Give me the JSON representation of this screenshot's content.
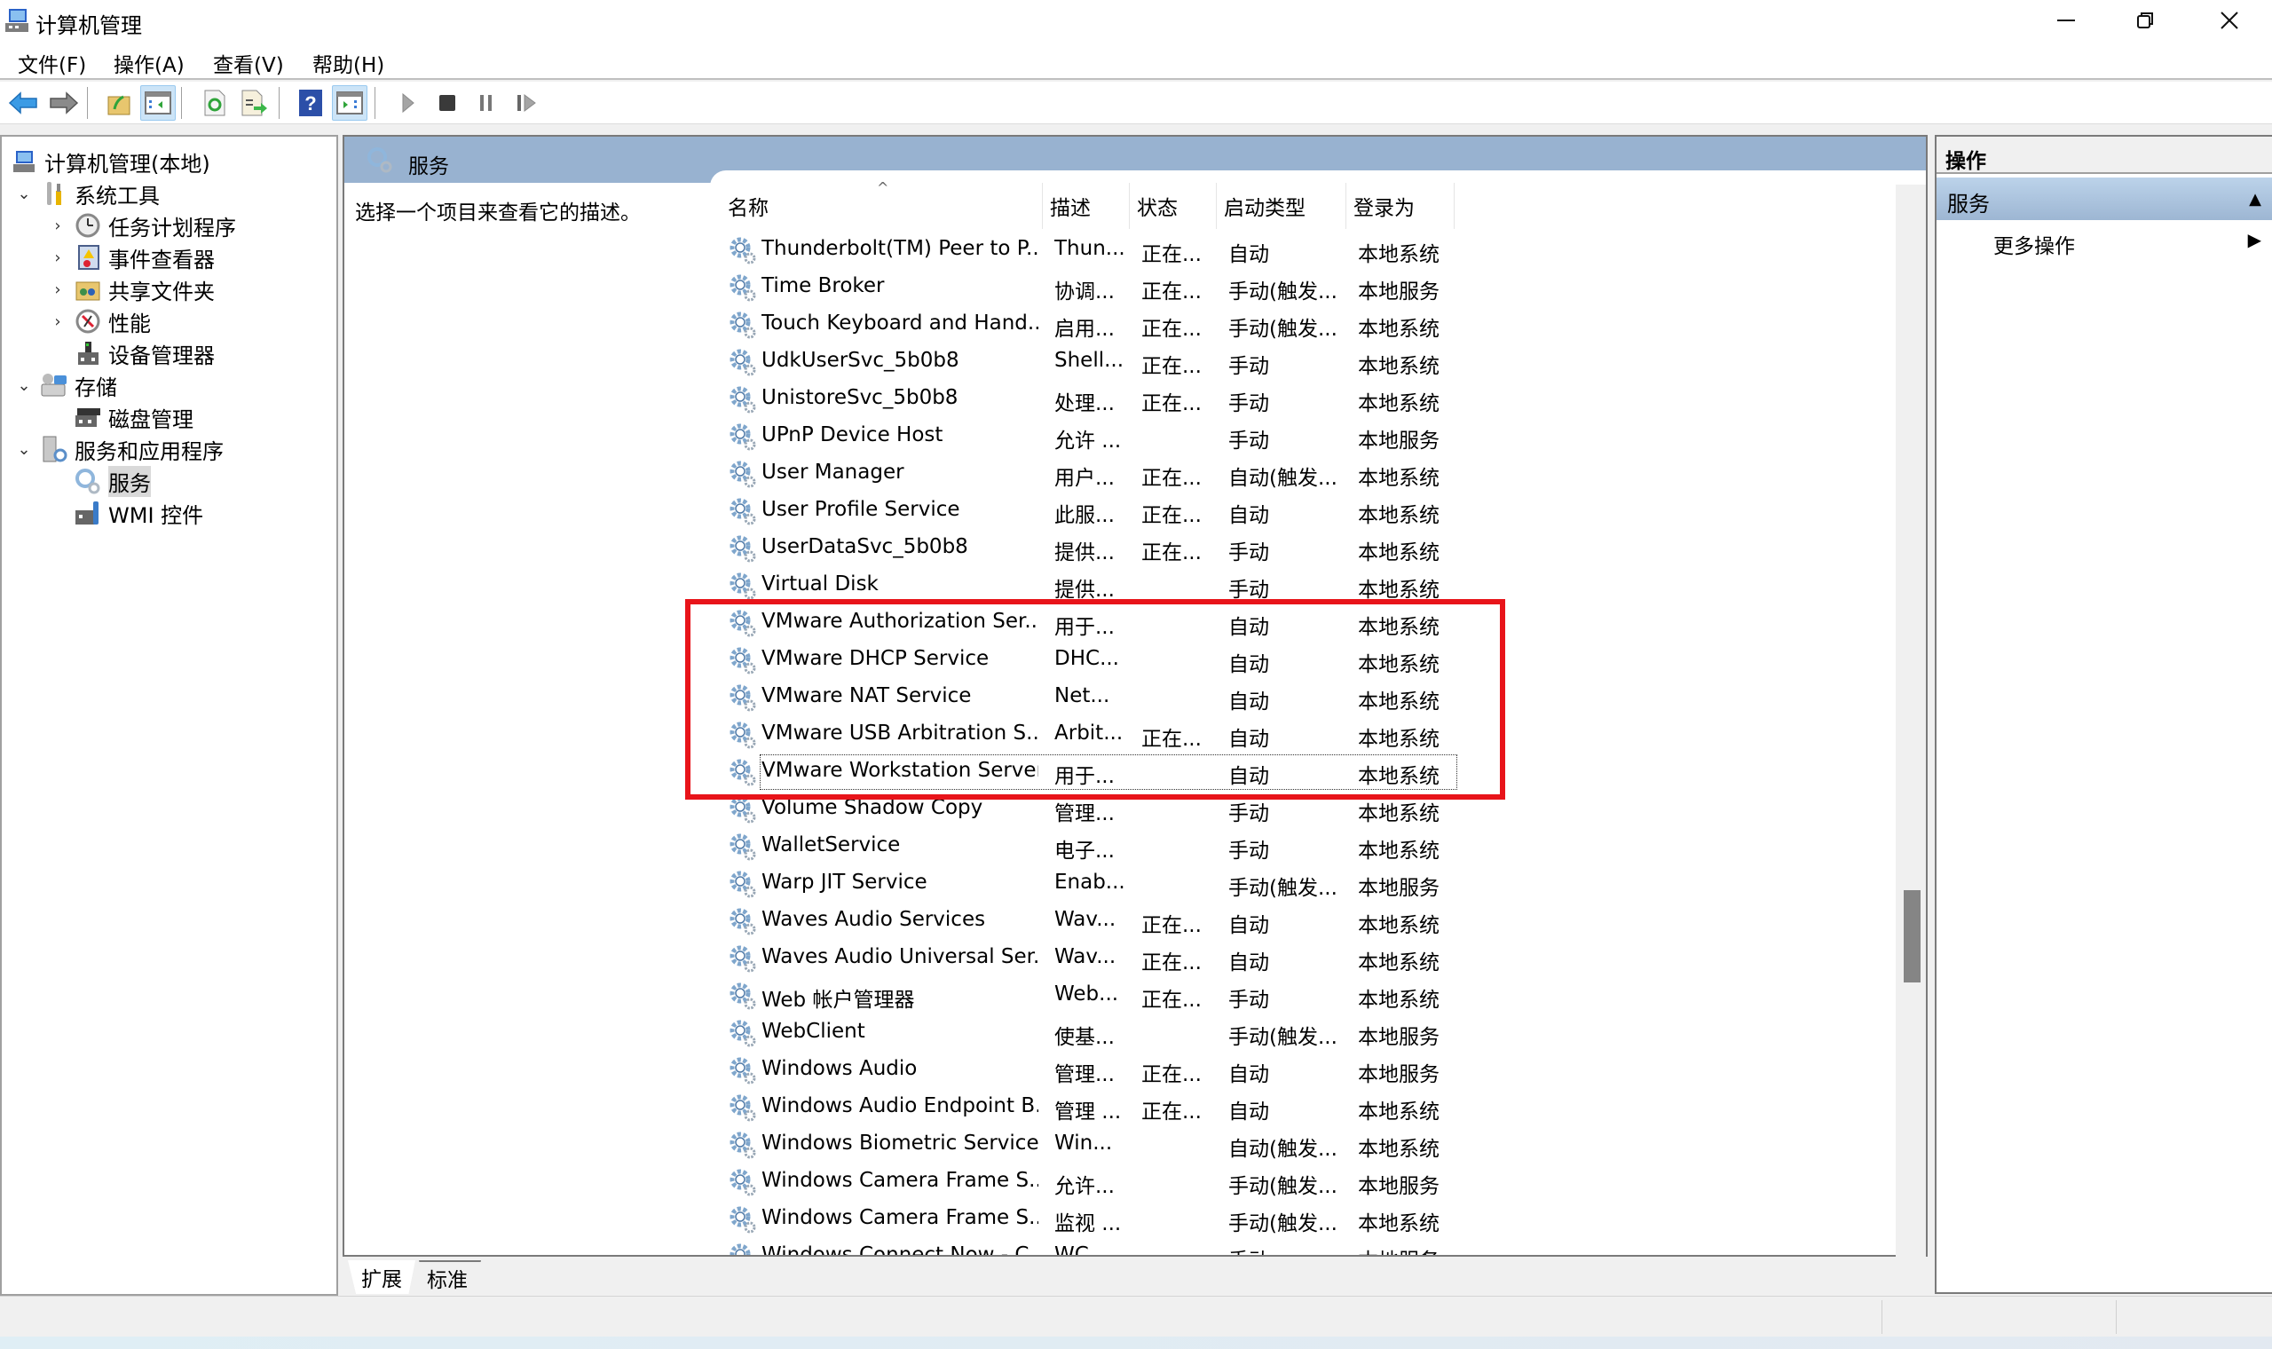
{
  "window": {
    "title": "计算机管理",
    "controls": {
      "minimize": "—",
      "maximize": "❐",
      "close": "✕"
    }
  },
  "menu": [
    {
      "label": "文件(F)"
    },
    {
      "label": "操作(A)"
    },
    {
      "label": "查看(V)"
    },
    {
      "label": "帮助(H)"
    }
  ],
  "toolbar": {
    "buttons": [
      {
        "icon": "back-arrow-icon",
        "label": "后退"
      },
      {
        "icon": "forward-arrow-icon",
        "label": "前进"
      },
      {
        "icon": "up-folder-icon",
        "label": "向上一级"
      },
      {
        "icon": "show-hide-console-tree-icon",
        "label": "显示/隐藏控制台树",
        "active": true
      },
      {
        "icon": "refresh-icon",
        "label": "刷新"
      },
      {
        "icon": "export-list-icon",
        "label": "导出列表"
      },
      {
        "icon": "help-icon",
        "label": "帮助"
      },
      {
        "icon": "show-hide-action-pane-icon",
        "label": "显示/隐藏操作窗格",
        "active": true
      },
      {
        "icon": "start-service-icon",
        "label": "启动服务"
      },
      {
        "icon": "stop-service-icon",
        "label": "停止服务"
      },
      {
        "icon": "pause-service-icon",
        "label": "暂停服务"
      },
      {
        "icon": "restart-service-icon",
        "label": "重新启动服务"
      }
    ]
  },
  "tree": [
    {
      "label": "计算机管理(本地)",
      "level": 0,
      "expander": "",
      "icon": "computer-management-icon"
    },
    {
      "label": "系统工具",
      "level": 1,
      "expander": "expanded",
      "icon": "system-tools-icon"
    },
    {
      "label": "任务计划程序",
      "level": 2,
      "expander": "collapsed",
      "icon": "task-scheduler-icon"
    },
    {
      "label": "事件查看器",
      "level": 2,
      "expander": "collapsed",
      "icon": "event-viewer-icon"
    },
    {
      "label": "共享文件夹",
      "level": 2,
      "expander": "collapsed",
      "icon": "shared-folders-icon"
    },
    {
      "label": "性能",
      "level": 2,
      "expander": "collapsed",
      "icon": "performance-icon"
    },
    {
      "label": "设备管理器",
      "level": 2,
      "expander": "",
      "icon": "device-manager-icon"
    },
    {
      "label": "存储",
      "level": 1,
      "expander": "expanded",
      "icon": "storage-icon"
    },
    {
      "label": "磁盘管理",
      "level": 2,
      "expander": "",
      "icon": "disk-management-icon"
    },
    {
      "label": "服务和应用程序",
      "level": 1,
      "expander": "expanded",
      "icon": "services-and-apps-icon"
    },
    {
      "label": "服务",
      "level": 2,
      "expander": "",
      "icon": "services-gear-icon",
      "selected": true
    },
    {
      "label": "WMI 控件",
      "level": 2,
      "expander": "",
      "icon": "wmi-control-icon"
    }
  ],
  "center": {
    "header_title": "服务",
    "description_hint": "选择一个项目来查看它的描述。",
    "columns": [
      {
        "key": "name",
        "label": "名称",
        "sorted": "ascending"
      },
      {
        "key": "desc",
        "label": "描述"
      },
      {
        "key": "status",
        "label": "状态"
      },
      {
        "key": "startup",
        "label": "启动类型"
      },
      {
        "key": "logon",
        "label": "登录为"
      }
    ],
    "sort_indicator": "^",
    "services": [
      {
        "name": "Thunderbolt(TM) Peer to P...",
        "desc": "Thun...",
        "status": "正在...",
        "startup": "自动",
        "logon": "本地系统"
      },
      {
        "name": "Time Broker",
        "desc": "协调...",
        "status": "正在...",
        "startup": "手动(触发...",
        "logon": "本地服务"
      },
      {
        "name": "Touch Keyboard and Hand...",
        "desc": "启用...",
        "status": "正在...",
        "startup": "手动(触发...",
        "logon": "本地系统"
      },
      {
        "name": "UdkUserSvc_5b0b8",
        "desc": "Shell...",
        "status": "正在...",
        "startup": "手动",
        "logon": "本地系统"
      },
      {
        "name": "UnistoreSvc_5b0b8",
        "desc": "处理...",
        "status": "正在...",
        "startup": "手动",
        "logon": "本地系统"
      },
      {
        "name": "UPnP Device Host",
        "desc": "允许 ...",
        "status": "",
        "startup": "手动",
        "logon": "本地服务"
      },
      {
        "name": "User Manager",
        "desc": "用户...",
        "status": "正在...",
        "startup": "自动(触发...",
        "logon": "本地系统"
      },
      {
        "name": "User Profile Service",
        "desc": "此服...",
        "status": "正在...",
        "startup": "自动",
        "logon": "本地系统"
      },
      {
        "name": "UserDataSvc_5b0b8",
        "desc": "提供...",
        "status": "正在...",
        "startup": "手动",
        "logon": "本地系统"
      },
      {
        "name": "Virtual Disk",
        "desc": "提供...",
        "status": "",
        "startup": "手动",
        "logon": "本地系统"
      },
      {
        "name": "VMware Authorization Ser...",
        "desc": "用于...",
        "status": "",
        "startup": "自动",
        "logon": "本地系统",
        "highlighted": true
      },
      {
        "name": "VMware DHCP Service",
        "desc": "DHC...",
        "status": "",
        "startup": "自动",
        "logon": "本地系统",
        "highlighted": true
      },
      {
        "name": "VMware NAT Service",
        "desc": "Net...",
        "status": "",
        "startup": "自动",
        "logon": "本地系统",
        "highlighted": true
      },
      {
        "name": "VMware USB Arbitration S...",
        "desc": "Arbit...",
        "status": "正在...",
        "startup": "自动",
        "logon": "本地系统",
        "highlighted": true
      },
      {
        "name": "VMware Workstation Server",
        "desc": "用于...",
        "status": "",
        "startup": "自动",
        "logon": "本地系统",
        "highlighted": true,
        "focused": true
      },
      {
        "name": "Volume Shadow Copy",
        "desc": "管理...",
        "status": "",
        "startup": "手动",
        "logon": "本地系统"
      },
      {
        "name": "WalletService",
        "desc": "电子...",
        "status": "",
        "startup": "手动",
        "logon": "本地系统"
      },
      {
        "name": "Warp JIT Service",
        "desc": "Enab...",
        "status": "",
        "startup": "手动(触发...",
        "logon": "本地服务"
      },
      {
        "name": "Waves Audio Services",
        "desc": "Wav...",
        "status": "正在...",
        "startup": "自动",
        "logon": "本地系统"
      },
      {
        "name": "Waves Audio Universal Ser...",
        "desc": "Wav...",
        "status": "正在...",
        "startup": "自动",
        "logon": "本地系统"
      },
      {
        "name": "Web 帐户管理器",
        "desc": "Web...",
        "status": "正在...",
        "startup": "手动",
        "logon": "本地系统"
      },
      {
        "name": "WebClient",
        "desc": "使基...",
        "status": "",
        "startup": "手动(触发...",
        "logon": "本地服务"
      },
      {
        "name": "Windows Audio",
        "desc": "管理...",
        "status": "正在...",
        "startup": "自动",
        "logon": "本地服务"
      },
      {
        "name": "Windows Audio Endpoint B...",
        "desc": "管理 ...",
        "status": "正在...",
        "startup": "自动",
        "logon": "本地系统"
      },
      {
        "name": "Windows Biometric Service",
        "desc": "Win...",
        "status": "",
        "startup": "自动(触发...",
        "logon": "本地系统"
      },
      {
        "name": "Windows Camera Frame S...",
        "desc": "允许...",
        "status": "",
        "startup": "手动(触发...",
        "logon": "本地服务"
      },
      {
        "name": "Windows Camera Frame S...",
        "desc": "监视 ...",
        "status": "",
        "startup": "手动(触发...",
        "logon": "本地系统"
      },
      {
        "name": "Windows Connect Now - C...",
        "desc": "WC...",
        "status": "",
        "startup": "手动",
        "logon": "本地服务"
      }
    ],
    "scroll_position_fraction": 0.72,
    "bottom_tabs": [
      {
        "label": "扩展",
        "active": true
      },
      {
        "label": "标准",
        "active": false
      }
    ]
  },
  "actions_pane": {
    "title": "操作",
    "section": "服务",
    "items": [
      {
        "label": "更多操作",
        "has_submenu": true
      }
    ],
    "collapse_glyph": "▲",
    "submenu_glyph": "▶"
  },
  "annotation": {
    "color": "#e8141a",
    "description": "red rectangle around VMware services"
  },
  "colors": {
    "header_band": "#98b2d0",
    "selected_tree_item": "#d9d9d9",
    "toolbar_active": "#cce4f7"
  }
}
